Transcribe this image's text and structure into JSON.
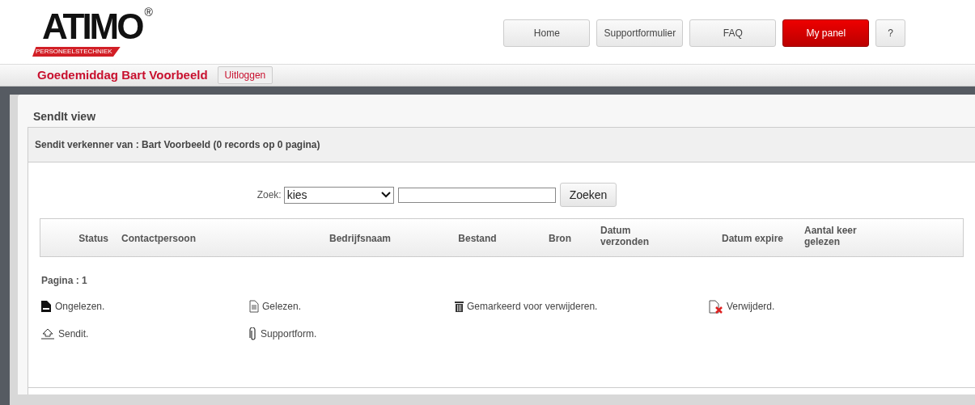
{
  "logo": {
    "name": "ATIMO",
    "registered": "®",
    "tagline": "PERSONEELSTECHNIEK"
  },
  "nav": [
    {
      "label": "Home",
      "selected": false
    },
    {
      "label": "Supportformulier",
      "selected": false
    },
    {
      "label": "FAQ",
      "selected": false
    },
    {
      "label": "My panel",
      "selected": true
    },
    {
      "label": "?",
      "selected": false
    }
  ],
  "greeting": {
    "text": "Goedemiddag **Bart Voorbeeld**",
    "logout": "Uitloggen"
  },
  "panel": {
    "title": "SendIt view",
    "subtitle": "Sendit verkenner van : Bart Voorbeeld (0 records op 0 pagina)"
  },
  "search": {
    "label": "Zoek:",
    "select_value": "kies",
    "button": "Zoeken"
  },
  "table": {
    "columns": [
      "Status",
      "Contactpersoon",
      "Bedrijfsnaam",
      "Bestand",
      "Bron",
      "Datum verzonden",
      "Datum expire",
      "Aantal keer gelezen"
    ]
  },
  "pagination": "Pagina : 1",
  "legend": [
    [
      {
        "kind": "unread",
        "label": "Ongelezen."
      },
      {
        "kind": "read",
        "label": "Gelezen."
      },
      {
        "kind": "trash",
        "label": "Gemarkeerd voor verwijderen."
      },
      {
        "kind": "deleted",
        "label": "Verwijderd."
      }
    ],
    [
      {
        "kind": "sendit",
        "label": "Sendit."
      },
      {
        "kind": "attachment",
        "label": "Supportform."
      }
    ]
  ]
}
